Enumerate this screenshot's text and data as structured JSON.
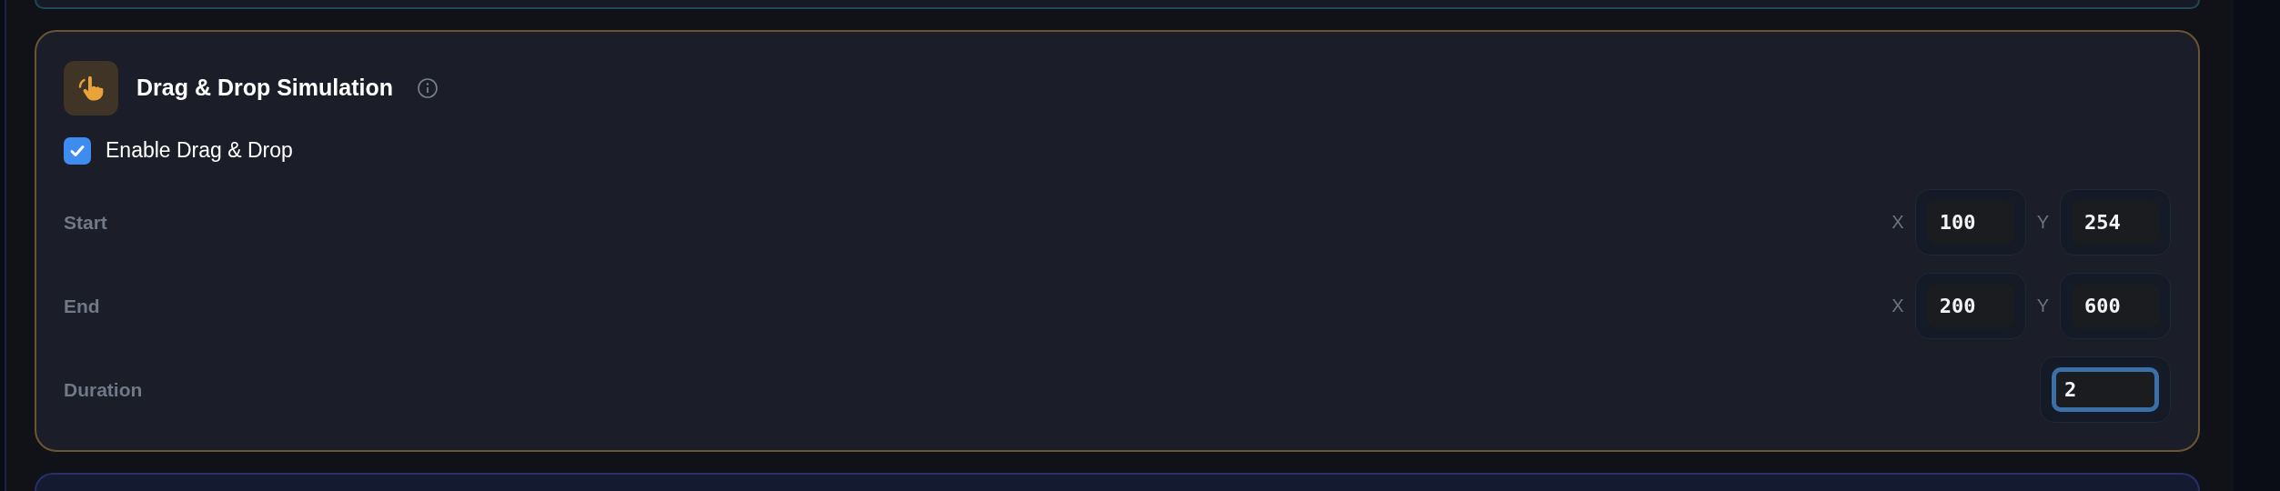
{
  "card": {
    "title": "Drag & Drop Simulation",
    "enable": {
      "label": "Enable Drag & Drop",
      "checked": true
    },
    "rows": [
      {
        "label": "Start",
        "kind": "point",
        "fields": [
          {
            "axis": "X",
            "value": "100",
            "focused": false
          },
          {
            "axis": "Y",
            "value": "254",
            "focused": false
          }
        ]
      },
      {
        "label": "End",
        "kind": "point",
        "fields": [
          {
            "axis": "X",
            "value": "200",
            "focused": false
          },
          {
            "axis": "Y",
            "value": "600",
            "focused": false
          }
        ]
      },
      {
        "label": "Duration",
        "kind": "single",
        "fields": [
          {
            "value": "2",
            "focused": true
          }
        ]
      }
    ]
  }
}
